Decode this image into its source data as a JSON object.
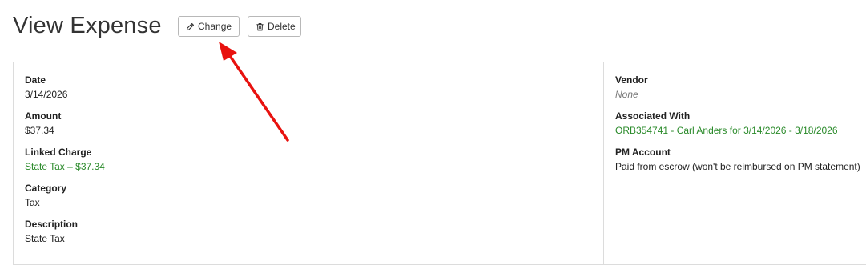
{
  "page": {
    "title": "View Expense"
  },
  "toolbar": {
    "change_label": "Change",
    "delete_label": "Delete"
  },
  "left_fields": [
    {
      "label": "Date",
      "value": "3/14/2026"
    },
    {
      "label": "Amount",
      "value": "$37.34"
    },
    {
      "label": "Linked Charge",
      "value": "State Tax – $37.34"
    },
    {
      "label": "Category",
      "value": "Tax"
    },
    {
      "label": "Description",
      "value": "State Tax"
    }
  ],
  "right_fields": [
    {
      "label": "Vendor",
      "value": "None"
    },
    {
      "label": "Associated With",
      "value": "ORB354741 - Carl Anders for 3/14/2026 - 3/18/2026"
    },
    {
      "label": "PM Account",
      "value": "Paid from escrow (won't be reimbursed on PM statement)"
    }
  ],
  "colors": {
    "link": "#2a8a2a",
    "annotation_arrow": "#e8120f"
  },
  "icons": {
    "change": "pencil-icon",
    "delete": "trash-icon"
  }
}
